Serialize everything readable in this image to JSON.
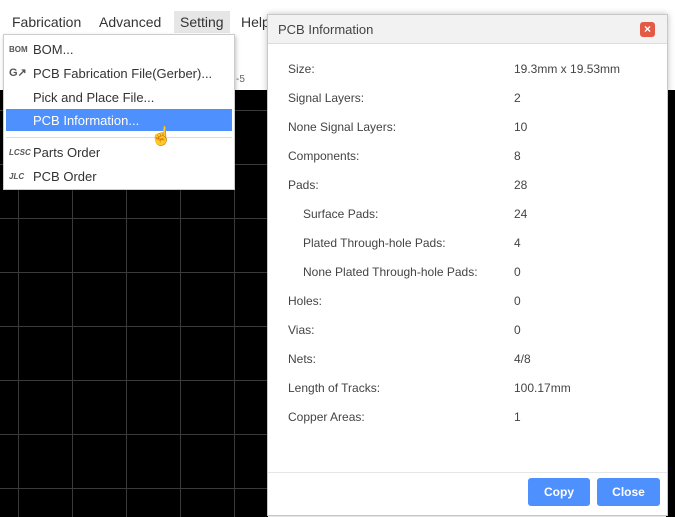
{
  "menubar": {
    "items": [
      {
        "label": "Fabrication"
      },
      {
        "label": "Advanced"
      },
      {
        "label": "Setting"
      },
      {
        "label": "Help"
      }
    ]
  },
  "ruler": {
    "ticks": [
      "-5"
    ]
  },
  "dropdown": {
    "items": [
      {
        "icon_text": "BOM",
        "label": "BOM..."
      },
      {
        "icon_text": "G↗",
        "label": "PCB Fabrication File(Gerber)..."
      },
      {
        "icon_text": "",
        "label": "Pick and Place File..."
      },
      {
        "icon_text": "",
        "label": "PCB Information...",
        "selected": true
      },
      {
        "icon_text": "LCSC",
        "label": "Parts Order"
      },
      {
        "icon_text": "JLC",
        "label": "PCB Order"
      }
    ]
  },
  "dialog": {
    "title": "PCB Information",
    "close_label": "×",
    "rows": [
      {
        "key": "Size:",
        "value": "19.3mm x 19.53mm"
      },
      {
        "key": "Signal Layers:",
        "value": "2"
      },
      {
        "key": "None Signal Layers:",
        "value": "10"
      },
      {
        "key": "Components:",
        "value": "8"
      },
      {
        "key": "Pads:",
        "value": "28"
      },
      {
        "key": "Surface Pads:",
        "value": "24"
      },
      {
        "key": "Plated Through-hole Pads:",
        "value": "4"
      },
      {
        "key": "None Plated Through-hole Pads:",
        "value": "0"
      },
      {
        "key": "Holes:",
        "value": "0"
      },
      {
        "key": "Vias:",
        "value": "0"
      },
      {
        "key": "Nets:",
        "value": "4/8"
      },
      {
        "key": "Length of Tracks:",
        "value": "100.17mm"
      },
      {
        "key": "Copper Areas:",
        "value": "1"
      }
    ],
    "copy_label": "Copy",
    "close_button_label": "Close"
  },
  "colors": {
    "accent": "#4d90fe",
    "close_red": "#e35b46",
    "canvas": "#000000"
  }
}
